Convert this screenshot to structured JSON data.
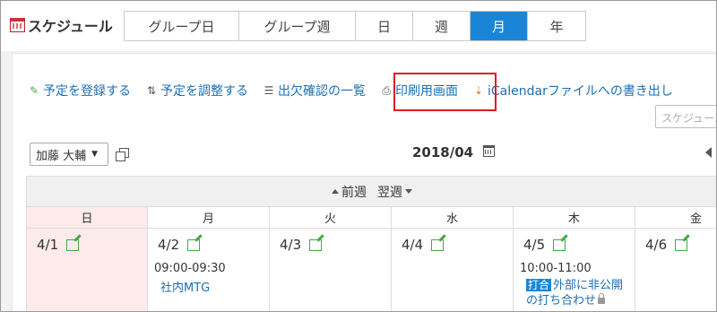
{
  "header": {
    "app_title": "スケジュール",
    "tabs": [
      {
        "label": "グループ日",
        "width": 128
      },
      {
        "label": "グループ週",
        "width": 130
      },
      {
        "label": "日",
        "width": 64
      },
      {
        "label": "週",
        "width": 64
      },
      {
        "label": "月",
        "width": 64,
        "active": true
      },
      {
        "label": "年",
        "width": 64
      }
    ]
  },
  "toolbar": {
    "register": "予定を登録する",
    "adjust": "予定を調整する",
    "attendance": "出欠確認の一覧",
    "print": "印刷用画面",
    "icalendar": "iCalendarファイルへの書き出し"
  },
  "search": {
    "placeholder": "スケジュール名"
  },
  "user_select": {
    "value": "加藤 大輔"
  },
  "month": {
    "label": "2018/04"
  },
  "nav": {
    "prev": "前週",
    "next": "翌週"
  },
  "weekdays": [
    "日",
    "月",
    "火",
    "水",
    "木",
    "金"
  ],
  "days": [
    {
      "date": "4/1"
    },
    {
      "date": "4/2",
      "event_time": "09:00-09:30",
      "event_title": "社内MTG"
    },
    {
      "date": "4/3"
    },
    {
      "date": "4/4"
    },
    {
      "date": "4/5",
      "event_time": "10:00-11:00",
      "event_badge": "打合",
      "event_title": "外部に非公開の打ち合わせ"
    },
    {
      "date": "4/6"
    }
  ],
  "colors": {
    "accent": "#1a85d6",
    "link": "#1a6fb3",
    "highlight": "#e01b1b",
    "sunday_bg": "#fdeaea"
  }
}
